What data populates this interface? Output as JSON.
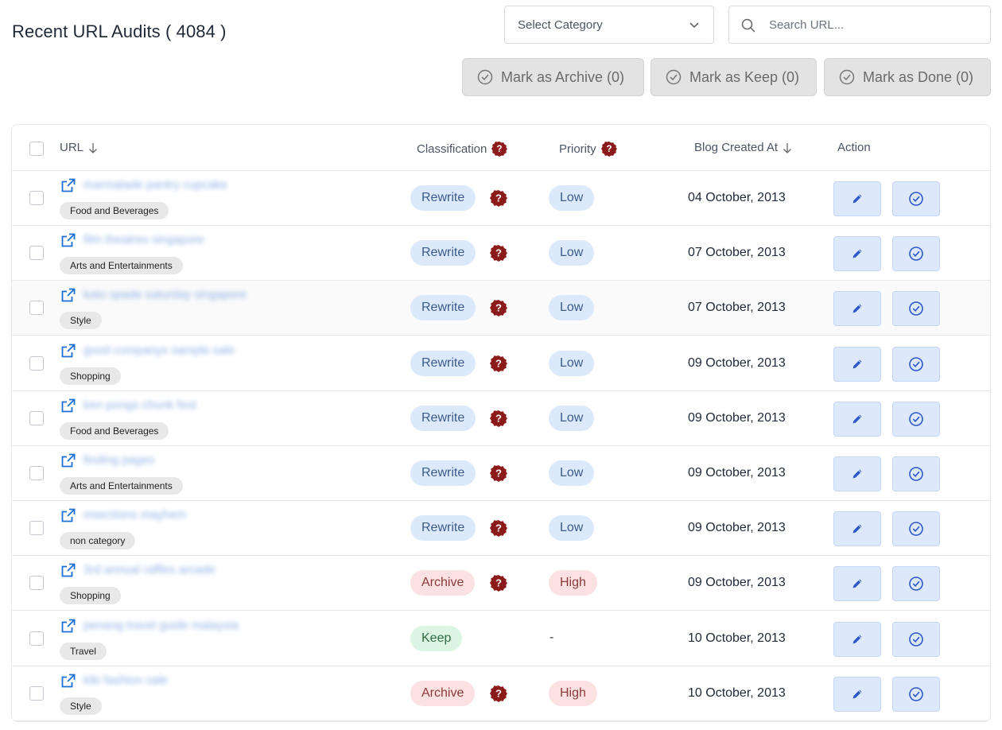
{
  "header": {
    "title": "Recent URL Audits ( 4084 )",
    "category_select": {
      "value": "Select Category"
    },
    "search": {
      "placeholder": "Search URL..."
    },
    "bulk_actions": [
      {
        "label": "Mark as Archive (0)"
      },
      {
        "label": "Mark as Keep (0)"
      },
      {
        "label": "Mark as Done (0)"
      }
    ]
  },
  "table": {
    "columns": {
      "url": "URL",
      "classification": "Classification",
      "priority": "Priority",
      "created": "Blog Created At",
      "action": "Action"
    },
    "rows": [
      {
        "url": "marmalade pantry cupcake",
        "category": "Food and Beverages",
        "classification": "Rewrite",
        "priority": "Low",
        "date": "04 October, 2013"
      },
      {
        "url": "film theatres singapore",
        "category": "Arts and Entertainments",
        "classification": "Rewrite",
        "priority": "Low",
        "date": "07 October, 2013"
      },
      {
        "url": "kato spade saturday singapore",
        "category": "Style",
        "classification": "Rewrite",
        "priority": "Low",
        "date": "07 October, 2013"
      },
      {
        "url": "good companys sample sale",
        "category": "Shopping",
        "classification": "Rewrite",
        "priority": "Low",
        "date": "09 October, 2013"
      },
      {
        "url": "ken pongs chunk fest",
        "category": "Food and Beverages",
        "classification": "Rewrite",
        "priority": "Low",
        "date": "09 October, 2013"
      },
      {
        "url": "finding pages",
        "category": "Arts and Entertainments",
        "classification": "Rewrite",
        "priority": "Low",
        "date": "09 October, 2013"
      },
      {
        "url": "msections mayhem",
        "category": "non category",
        "classification": "Rewrite",
        "priority": "Low",
        "date": "09 October, 2013"
      },
      {
        "url": "3rd annual raffles arcade",
        "category": "Shopping",
        "classification": "Archive",
        "priority": "High",
        "date": "09 October, 2013"
      },
      {
        "url": "penang travel guide malaysia",
        "category": "Travel",
        "classification": "Keep",
        "priority": "-",
        "date": "10 October, 2013"
      },
      {
        "url": "kiki fashion sale",
        "category": "Style",
        "classification": "Archive",
        "priority": "High",
        "date": "10 October, 2013"
      }
    ]
  },
  "colors": {
    "accent": "#2563eb",
    "help_badge": "#8b1a1a",
    "action_bg": "#dde8fb"
  }
}
